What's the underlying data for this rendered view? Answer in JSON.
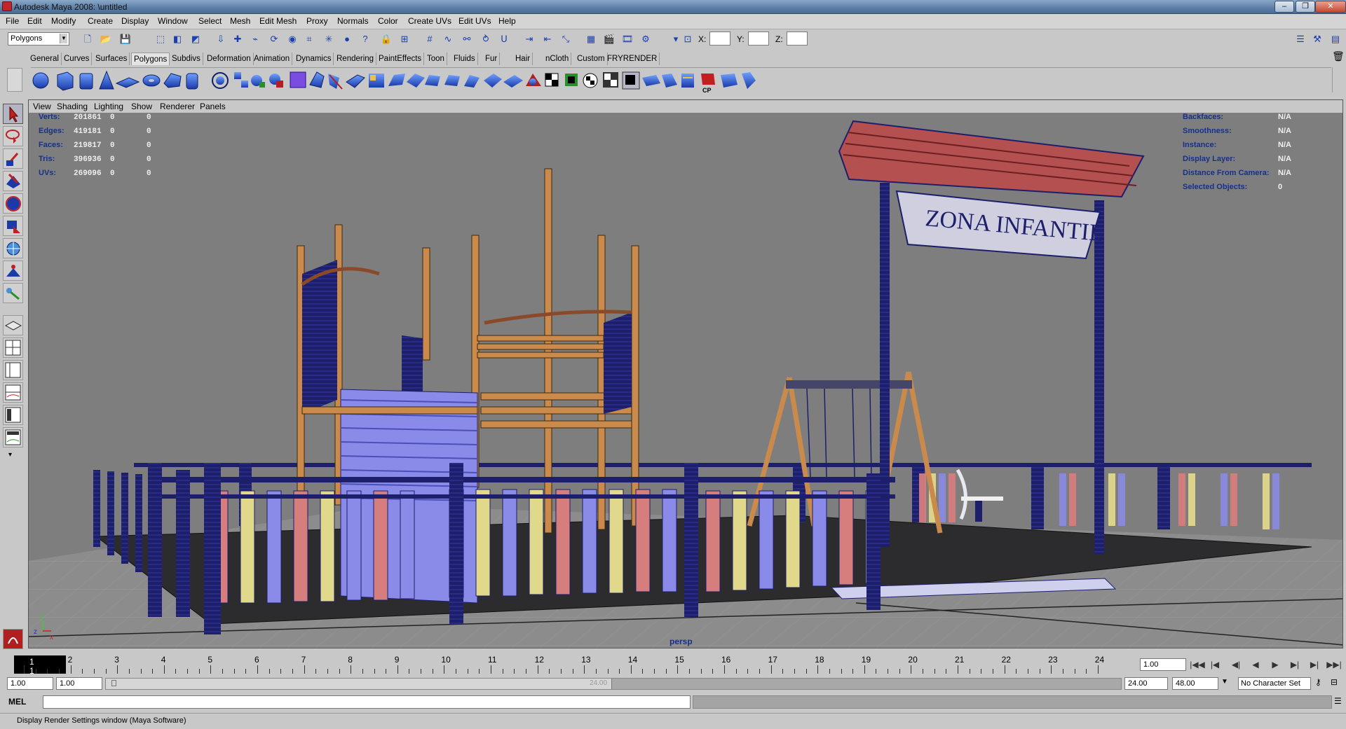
{
  "window": {
    "title": "Autodesk Maya 2008: \\untitled",
    "minimize": "–",
    "maximize": "❐",
    "close": "✕"
  },
  "menubar": {
    "items": [
      "File",
      "Edit",
      "Modify",
      "Create",
      "Display",
      "Window",
      "Select",
      "Mesh",
      "Edit Mesh",
      "Proxy",
      "Normals",
      "Color",
      "Create UVs",
      "Edit UVs",
      "Help"
    ]
  },
  "statusline": {
    "mode": "Polygons",
    "x_label": "X:",
    "y_label": "Y:",
    "z_label": "Z:",
    "x_value": "",
    "y_value": "",
    "z_value": ""
  },
  "shelf": {
    "tabs": [
      "General",
      "Curves",
      "Surfaces",
      "Polygons",
      "Subdivs",
      "Deformation",
      "Animation",
      "Dynamics",
      "Rendering",
      "PaintEffects",
      "Toon",
      "Fluids",
      "Fur",
      "Hair",
      "nCloth",
      "Custom",
      "FRYRENDER"
    ],
    "active_tab": "Polygons",
    "cp_label": "CP"
  },
  "panel_menu": {
    "items": [
      "View",
      "Shading",
      "Lighting",
      "Show",
      "Renderer",
      "Panels"
    ]
  },
  "hud_left": {
    "rows": [
      {
        "label": "Verts:",
        "total": "201861",
        "selected": "0",
        "components": "0"
      },
      {
        "label": "Edges:",
        "total": "419181",
        "selected": "0",
        "components": "0"
      },
      {
        "label": "Faces:",
        "total": "219817",
        "selected": "0",
        "components": "0"
      },
      {
        "label": "Tris:",
        "total": "396936",
        "selected": "0",
        "components": "0"
      },
      {
        "label": "UVs:",
        "total": "269096",
        "selected": "0",
        "components": "0"
      }
    ]
  },
  "hud_right": {
    "rows": [
      {
        "label": "Backfaces:",
        "value": "N/A"
      },
      {
        "label": "Smoothness:",
        "value": "N/A"
      },
      {
        "label": "Instance:",
        "value": "N/A"
      },
      {
        "label": "Display Layer:",
        "value": "N/A"
      },
      {
        "label": "Distance From Camera:",
        "value": "N/A"
      },
      {
        "label": "Selected Objects:",
        "value": "0"
      }
    ]
  },
  "viewport": {
    "camera": "persp",
    "sign_text": "ZONA INFANTIL",
    "axis_y": "y",
    "axis_z": "z",
    "axis_x": "x"
  },
  "timeslider": {
    "frames": [
      "1",
      "2",
      "3",
      "4",
      "5",
      "6",
      "7",
      "8",
      "9",
      "10",
      "11",
      "12",
      "13",
      "14",
      "15",
      "16",
      "17",
      "18",
      "19",
      "20",
      "21",
      "22",
      "23",
      "24"
    ],
    "current_frame": "1",
    "current_frame_field": "1.00"
  },
  "playback": {
    "buttons": [
      "|◀◀",
      "|◀",
      "◀|",
      "◀",
      "▶",
      "▶|",
      "▶|",
      "▶▶|"
    ]
  },
  "range": {
    "start": "1.00",
    "playback_start": "1.00",
    "playback_end": "24.00",
    "end": "48.00",
    "slider_label": "24.00",
    "character_set": "No Character Set"
  },
  "commandline": {
    "label": "MEL",
    "input": ""
  },
  "helpline": {
    "text": "Display Render Settings window (Maya Software)"
  },
  "colors": {
    "title_bar": "#5c7ea6",
    "viewport_bg": "#7e7e7e",
    "hud_label": "#17308a",
    "wire": "#1c2070"
  }
}
